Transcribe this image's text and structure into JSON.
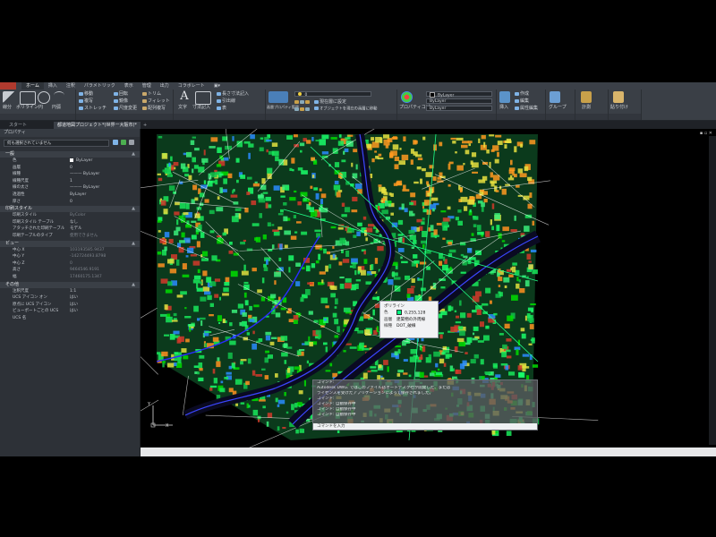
{
  "menu": {
    "tabs": [
      "ホーム",
      "挿入",
      "注釈",
      "パラメトリック",
      "表示",
      "管理",
      "出力",
      "コラボレート",
      "▣▾"
    ],
    "active_index": 0
  },
  "ribbon": {
    "groups": {
      "group": "グループ"
    },
    "draw": {
      "line": "線分",
      "polyline": "ポリライン",
      "circle": "円",
      "arc": "円弧"
    },
    "modify": {
      "move": "移動",
      "rotate": "回転",
      "trim": "トリム",
      "copy": "複写",
      "mirror": "鏡像",
      "fillet": "フィレット",
      "stretch": "ストレッチ",
      "scale": "尺度変更",
      "array": "配列複写"
    },
    "annotation": {
      "text": "文字",
      "dimension": "寸法記入",
      "leader": "引出線",
      "table": "表",
      "linear": "長さ寸法記入"
    },
    "layers": {
      "properties": "画層プロパティ管理",
      "current_layer": "0",
      "make_current": "現在層に設定",
      "match_layer": "オブジェクトを現在の画層に移動"
    },
    "properties": {
      "match": "プロパティコピー",
      "color": "ByLayer",
      "linetype": "ByLayer",
      "lineweight": "ByLayer"
    },
    "block": {
      "insert": "挿入",
      "create": "作成",
      "edit": "編集",
      "attr_edit": "属性編集"
    },
    "utilities": {
      "measure": "計測"
    },
    "clipboard": {
      "paste": "貼り付け"
    }
  },
  "doc_tabs": [
    "スタート",
    "都道地図プロジェクト*(世界ー大阪市)*",
    "+"
  ],
  "properties_panel": {
    "title": "プロパティ",
    "selection": "何も選択されていません",
    "sections": [
      {
        "title": "一般",
        "rows": [
          {
            "k": "色",
            "v": "ByLayer",
            "swatch": true
          },
          {
            "k": "画層",
            "v": "0"
          },
          {
            "k": "線種",
            "v": "——— ByLayer"
          },
          {
            "k": "線種尺度",
            "v": "1"
          },
          {
            "k": "線の太さ",
            "v": "——— ByLayer"
          },
          {
            "k": "透過性",
            "v": "ByLayer"
          },
          {
            "k": "厚さ",
            "v": "0"
          }
        ]
      },
      {
        "title": "印刷スタイル",
        "rows": [
          {
            "k": "印刷スタイル",
            "v": "ByColor",
            "dim": true
          },
          {
            "k": "印刷スタイル テーブル",
            "v": "なし"
          },
          {
            "k": "アタッチされた印刷テーブル",
            "v": "モデル"
          },
          {
            "k": "印刷テーブルのタイプ",
            "v": "使用できません",
            "dim": true
          }
        ]
      },
      {
        "title": "ビュー",
        "rows": [
          {
            "k": "中心 X",
            "v": "103193585.9437",
            "dim": true
          },
          {
            "k": "中心 Y",
            "v": "-142724493.8798",
            "dim": true
          },
          {
            "k": "中心 Z",
            "v": "0",
            "dim": true
          },
          {
            "k": "高さ",
            "v": "9464546.9191",
            "dim": true
          },
          {
            "k": "幅",
            "v": "17460175.1347",
            "dim": true
          }
        ]
      },
      {
        "title": "その他",
        "rows": [
          {
            "k": "注釈尺度",
            "v": "1:1"
          },
          {
            "k": "UCS アイコン オン",
            "v": "はい"
          },
          {
            "k": "原点に UCS アイコン",
            "v": "はい"
          },
          {
            "k": "ビューポートごとの UCS",
            "v": "はい"
          },
          {
            "k": "UCS 名",
            "v": ""
          }
        ]
      }
    ]
  },
  "viewport": {
    "controls": "▪ ▫ ✕"
  },
  "tooltip": {
    "title": "ポリライン",
    "rows": [
      {
        "k": "色",
        "v": "0,255,128"
      },
      {
        "k": "画層",
        "v": "建築物の外周線"
      },
      {
        "k": "線種",
        "v": "DOT_破線"
      }
    ],
    "swatch": "#00ff80"
  },
  "command_line": {
    "lines": [
      "コマンド:",
      "Autodesk DWG. ではこのファイルはオートデスク社が開発した、または",
      "ライセンスを受けたアプリケーションによって保存されました。",
      "コマンド:",
      "コマンド: 自動保存中",
      "コマンド: 自動保存中",
      "コマンド: 自動保存中"
    ],
    "input_placeholder": "コマンドを入力"
  },
  "ucs": {
    "x": "X",
    "y": "Y"
  },
  "colors": {
    "accent": "#5e9ed6",
    "map_green": "#19e85a",
    "app_red": "#b03a2e"
  }
}
